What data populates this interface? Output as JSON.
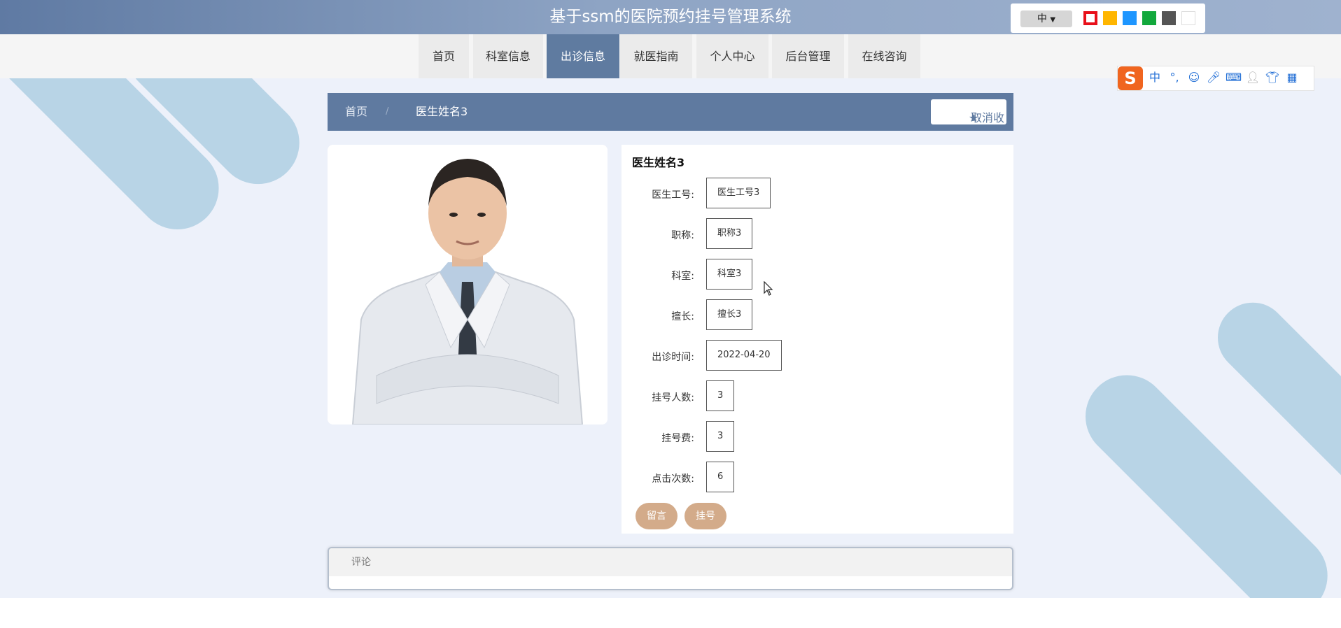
{
  "header": {
    "title": "基于ssm的医院预约挂号管理系统"
  },
  "theme_switcher": {
    "lang_label": "中",
    "swatches": [
      "#e8101a",
      "#ffb600",
      "#1e96ff",
      "#12a83c",
      "#555555",
      "#ffffff"
    ]
  },
  "nav": {
    "items": [
      {
        "label": "首页"
      },
      {
        "label": "科室信息"
      },
      {
        "label": "出诊信息",
        "active": true
      },
      {
        "label": "就医指南"
      },
      {
        "label": "个人中心"
      },
      {
        "label": "后台管理"
      },
      {
        "label": "在线咨询"
      }
    ]
  },
  "ime_toolbar": {
    "logo": "S",
    "mode": "中",
    "punct": "°,"
  },
  "breadcrumb": {
    "home": "首页",
    "separator": "/",
    "current": "医生姓名3"
  },
  "favorite": {
    "label": "取消收藏",
    "icon": "star-icon"
  },
  "doctor": {
    "name": "医生姓名3",
    "fields": [
      {
        "label": "医生工号:",
        "value": "医生工号3"
      },
      {
        "label": "职称:",
        "value": "职称3"
      },
      {
        "label": "科室:",
        "value": "科室3"
      },
      {
        "label": "擅长:",
        "value": "擅长3"
      },
      {
        "label": "出诊时间:",
        "value": "2022-04-20"
      },
      {
        "label": "挂号人数:",
        "value": "3"
      },
      {
        "label": "挂号费:",
        "value": "3"
      },
      {
        "label": "点击次数:",
        "value": "6"
      }
    ]
  },
  "actions": {
    "message": "留言",
    "register": "挂号"
  },
  "comments": {
    "tab_label": "评论"
  },
  "colors": {
    "header": "#5f7aa0",
    "accent_button": "#d3ab8a",
    "background": "#edf1fa"
  }
}
